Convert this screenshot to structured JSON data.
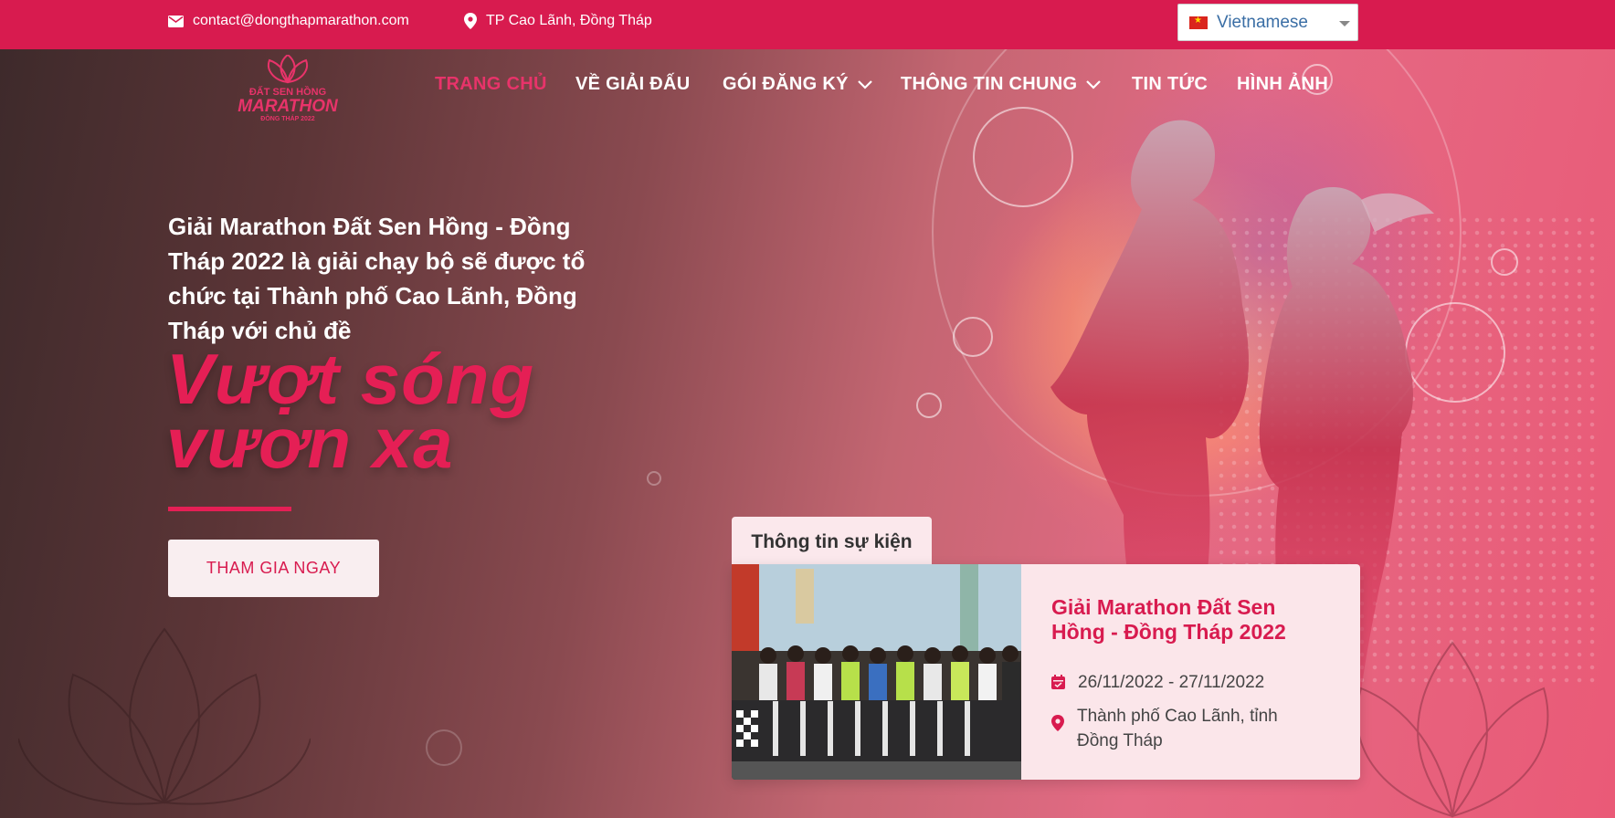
{
  "topbar": {
    "email": "contact@dongthapmarathon.com",
    "location": "TP Cao Lãnh, Đồng Tháp",
    "language": "Vietnamese"
  },
  "logo": {
    "line1": "ĐẤT SEN HỒNG",
    "line2": "MARATHON",
    "line3": "ĐỒNG THÁP 2022"
  },
  "nav": {
    "items": [
      {
        "label": "TRANG CHỦ",
        "active": true
      },
      {
        "label": "VỀ GIẢI ĐẤU"
      },
      {
        "label": "GÓI ĐĂNG KÝ",
        "dropdown": true
      },
      {
        "label": "THÔNG TIN CHUNG",
        "dropdown": true
      },
      {
        "label": "TIN TỨC"
      },
      {
        "label": "HÌNH ẢNH"
      }
    ]
  },
  "hero": {
    "intro": "Giải Marathon Đất Sen Hồng - Đồng Tháp 2022 là giải chạy bộ sẽ được tổ chức tại Thành phố Cao Lãnh, Đồng Tháp với chủ đề",
    "slogan_line1": "Vượt sóng",
    "slogan_line2": "vươn xa",
    "cta_label": "THAM GIA NGAY"
  },
  "event": {
    "tab_label": "Thông tin sự kiện",
    "title": "Giải Marathon Đất Sen Hồng - Đồng Tháp 2022",
    "dates": "26/11/2022 - 27/11/2022",
    "place": "Thành phố Cao Lãnh, tỉnh Đồng Tháp"
  },
  "colors": {
    "brand": "#d81b4f",
    "accent": "#e51f55"
  }
}
